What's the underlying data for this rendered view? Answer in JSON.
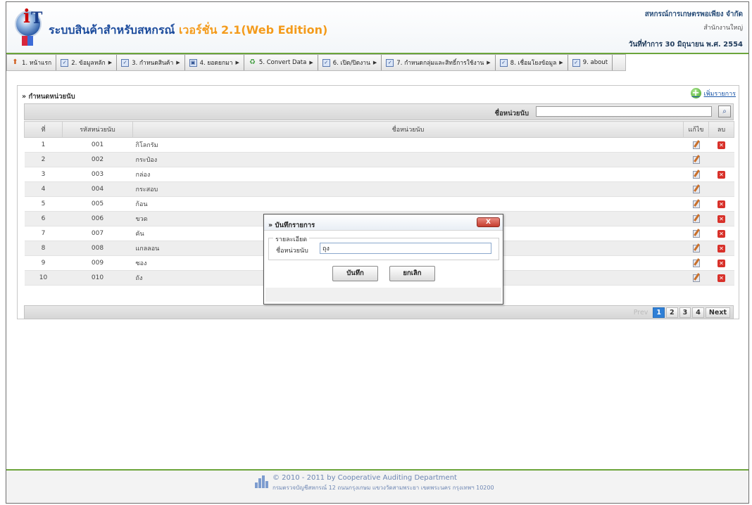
{
  "header": {
    "title": "ระบบสินค้าสำหรับสหกรณ์",
    "version": "เวอร์ชั่น 2.1(Web Edition)",
    "coop_name": "สหกรณ์การเกษตรพอเพียง จำกัด",
    "branch": "สำนักงานใหญ่",
    "work_date": "วันที่ทำการ 30 มิถุนายน พ.ศ. 2554"
  },
  "menu": [
    {
      "label": "1. หน้าแรก",
      "icon": "home-icon",
      "has_arrow": false
    },
    {
      "label": "2. ข้อมูลหลัก",
      "icon": "doc-icon",
      "has_arrow": true
    },
    {
      "label": "3. กำหนดสินค้า",
      "icon": "doc-icon",
      "has_arrow": true
    },
    {
      "label": "4. ยอดยกมา",
      "icon": "calendar-icon",
      "has_arrow": true
    },
    {
      "label": "5. Convert Data",
      "icon": "convert-icon",
      "has_arrow": true
    },
    {
      "label": "6. เปิด/ปิดงาน",
      "icon": "doc-icon",
      "has_arrow": true
    },
    {
      "label": "7. กำหนดกลุ่มและสิทธิ์การใช้งาน",
      "icon": "doc-icon",
      "has_arrow": true
    },
    {
      "label": "8. เชื่อมโยงข้อมูล",
      "icon": "doc-icon",
      "has_arrow": true
    },
    {
      "label": "9. about",
      "icon": "doc-icon",
      "has_arrow": false
    }
  ],
  "panel": {
    "title": "» กำหนดหน่วยนับ",
    "add_label": "เพิ่มรายการ",
    "search_label": "ชื่อหน่วยนับ",
    "search_value": ""
  },
  "table": {
    "columns": [
      "ที่",
      "รหัสหน่วยนับ",
      "ชื่อหน่วยนับ",
      "แก้ไข",
      "ลบ"
    ],
    "rows": [
      {
        "no": "1",
        "code": "001",
        "name": "กิโลกรัม",
        "deletable": true
      },
      {
        "no": "2",
        "code": "002",
        "name": "กระป๋อง",
        "deletable": false
      },
      {
        "no": "3",
        "code": "003",
        "name": "กล่อง",
        "deletable": true
      },
      {
        "no": "4",
        "code": "004",
        "name": "กระสอบ",
        "deletable": false
      },
      {
        "no": "5",
        "code": "005",
        "name": "ก้อน",
        "deletable": true
      },
      {
        "no": "6",
        "code": "006",
        "name": "ขวด",
        "deletable": true
      },
      {
        "no": "7",
        "code": "007",
        "name": "คัน",
        "deletable": true
      },
      {
        "no": "8",
        "code": "008",
        "name": "แกลลอน",
        "deletable": true
      },
      {
        "no": "9",
        "code": "009",
        "name": "ซอง",
        "deletable": true
      },
      {
        "no": "10",
        "code": "010",
        "name": "ถัง",
        "deletable": true
      }
    ]
  },
  "pager": {
    "prev": "Prev",
    "pages": [
      "1",
      "2",
      "3",
      "4"
    ],
    "current": "1",
    "next": "Next"
  },
  "modal": {
    "title": "» บันทึกรายการ",
    "close": "X",
    "legend": "รายละเอียด",
    "field_label": "ชื่อหน่วยนับ",
    "field_value": "ถุง",
    "save": "บันทึก",
    "cancel": "ยกเลิก"
  },
  "footer": {
    "line1": "© 2010 - 2011  by Cooperative Auditing Department",
    "line2": "กรมตรวจบัญชีสหกรณ์ 12 ถนนกรุงเกษม แขวงวัดสามพระยา เขตพระนคร กรุงเทพฯ 10200"
  },
  "colors": {
    "accent_green": "#6ca53b",
    "title_blue": "#1b4b9c",
    "version_orange": "#f39b1c",
    "pager_current": "#2f7fd6",
    "delete_red": "#d8312a"
  }
}
